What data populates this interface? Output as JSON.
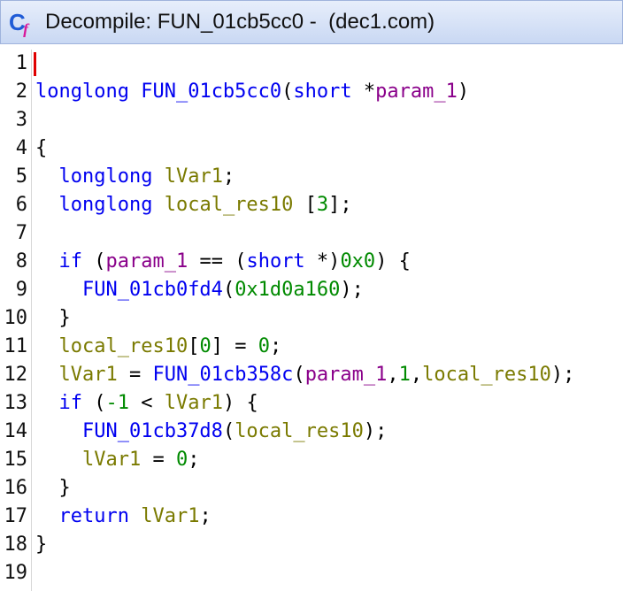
{
  "window": {
    "title": "Decompile: FUN_01cb5cc0 -  (dec1.com)",
    "icon": "decompiler-icon",
    "icon_letters": "Cf"
  },
  "colors": {
    "keyword": "#0000f0",
    "function": "#0000f0",
    "parameter": "#8a008a",
    "local_variable": "#7a7a00",
    "number": "#008a00",
    "cursor": "#e00000",
    "titlebar": "#c9d8f3"
  },
  "editor": {
    "cursor_line": 1,
    "lines": [
      {
        "num": "1",
        "tokens": []
      },
      {
        "num": "2",
        "tokens": [
          {
            "t": "longlong",
            "c": "kw"
          },
          {
            "t": " ",
            "c": "pc"
          },
          {
            "t": "FUN_01cb5cc0",
            "c": "fn"
          },
          {
            "t": "(",
            "c": "pc"
          },
          {
            "t": "short",
            "c": "kw"
          },
          {
            "t": " *",
            "c": "pc"
          },
          {
            "t": "param_1",
            "c": "pm"
          },
          {
            "t": ")",
            "c": "pc"
          }
        ]
      },
      {
        "num": "3",
        "tokens": []
      },
      {
        "num": "4",
        "tokens": [
          {
            "t": "{",
            "c": "pc"
          }
        ]
      },
      {
        "num": "5",
        "tokens": [
          {
            "t": "  ",
            "c": "pc"
          },
          {
            "t": "longlong",
            "c": "kw"
          },
          {
            "t": " ",
            "c": "pc"
          },
          {
            "t": "lVar1",
            "c": "lv"
          },
          {
            "t": ";",
            "c": "pc"
          }
        ]
      },
      {
        "num": "6",
        "tokens": [
          {
            "t": "  ",
            "c": "pc"
          },
          {
            "t": "longlong",
            "c": "kw"
          },
          {
            "t": " ",
            "c": "pc"
          },
          {
            "t": "local_res10",
            "c": "lv"
          },
          {
            "t": " [",
            "c": "pc"
          },
          {
            "t": "3",
            "c": "nm"
          },
          {
            "t": "];",
            "c": "pc"
          }
        ]
      },
      {
        "num": "7",
        "tokens": []
      },
      {
        "num": "8",
        "tokens": [
          {
            "t": "  ",
            "c": "pc"
          },
          {
            "t": "if",
            "c": "kw"
          },
          {
            "t": " (",
            "c": "pc"
          },
          {
            "t": "param_1",
            "c": "pm"
          },
          {
            "t": " == (",
            "c": "pc"
          },
          {
            "t": "short",
            "c": "kw"
          },
          {
            "t": " *)",
            "c": "pc"
          },
          {
            "t": "0x0",
            "c": "nm"
          },
          {
            "t": ") {",
            "c": "pc"
          }
        ]
      },
      {
        "num": "9",
        "tokens": [
          {
            "t": "    ",
            "c": "pc"
          },
          {
            "t": "FUN_01cb0fd4",
            "c": "fn"
          },
          {
            "t": "(",
            "c": "pc"
          },
          {
            "t": "0x1d0a160",
            "c": "nm"
          },
          {
            "t": ");",
            "c": "pc"
          }
        ]
      },
      {
        "num": "10",
        "tokens": [
          {
            "t": "  }",
            "c": "pc"
          }
        ]
      },
      {
        "num": "11",
        "tokens": [
          {
            "t": "  ",
            "c": "pc"
          },
          {
            "t": "local_res10",
            "c": "lv"
          },
          {
            "t": "[",
            "c": "pc"
          },
          {
            "t": "0",
            "c": "nm"
          },
          {
            "t": "] = ",
            "c": "pc"
          },
          {
            "t": "0",
            "c": "nm"
          },
          {
            "t": ";",
            "c": "pc"
          }
        ]
      },
      {
        "num": "12",
        "tokens": [
          {
            "t": "  ",
            "c": "pc"
          },
          {
            "t": "lVar1",
            "c": "lv"
          },
          {
            "t": " = ",
            "c": "pc"
          },
          {
            "t": "FUN_01cb358c",
            "c": "fn"
          },
          {
            "t": "(",
            "c": "pc"
          },
          {
            "t": "param_1",
            "c": "pm"
          },
          {
            "t": ",",
            "c": "pc"
          },
          {
            "t": "1",
            "c": "nm"
          },
          {
            "t": ",",
            "c": "pc"
          },
          {
            "t": "local_res10",
            "c": "lv"
          },
          {
            "t": ");",
            "c": "pc"
          }
        ]
      },
      {
        "num": "13",
        "tokens": [
          {
            "t": "  ",
            "c": "pc"
          },
          {
            "t": "if",
            "c": "kw"
          },
          {
            "t": " (",
            "c": "pc"
          },
          {
            "t": "-1",
            "c": "nm"
          },
          {
            "t": " < ",
            "c": "pc"
          },
          {
            "t": "lVar1",
            "c": "lv"
          },
          {
            "t": ") {",
            "c": "pc"
          }
        ]
      },
      {
        "num": "14",
        "tokens": [
          {
            "t": "    ",
            "c": "pc"
          },
          {
            "t": "FUN_01cb37d8",
            "c": "fn"
          },
          {
            "t": "(",
            "c": "pc"
          },
          {
            "t": "local_res10",
            "c": "lv"
          },
          {
            "t": ");",
            "c": "pc"
          }
        ]
      },
      {
        "num": "15",
        "tokens": [
          {
            "t": "    ",
            "c": "pc"
          },
          {
            "t": "lVar1",
            "c": "lv"
          },
          {
            "t": " = ",
            "c": "pc"
          },
          {
            "t": "0",
            "c": "nm"
          },
          {
            "t": ";",
            "c": "pc"
          }
        ]
      },
      {
        "num": "16",
        "tokens": [
          {
            "t": "  }",
            "c": "pc"
          }
        ]
      },
      {
        "num": "17",
        "tokens": [
          {
            "t": "  ",
            "c": "pc"
          },
          {
            "t": "return",
            "c": "kw"
          },
          {
            "t": " ",
            "c": "pc"
          },
          {
            "t": "lVar1",
            "c": "lv"
          },
          {
            "t": ";",
            "c": "pc"
          }
        ]
      },
      {
        "num": "18",
        "tokens": [
          {
            "t": "}",
            "c": "pc"
          }
        ]
      },
      {
        "num": "19",
        "tokens": []
      }
    ]
  }
}
